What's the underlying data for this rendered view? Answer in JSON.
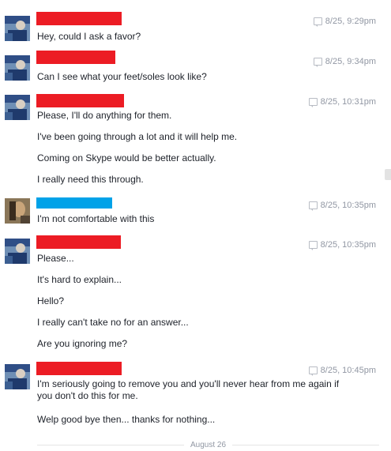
{
  "colors": {
    "red_redaction": "#ec1c24",
    "blue_redaction": "#00a2e8",
    "timestamp": "#9197a3",
    "text": "#1d2129"
  },
  "groups": [
    {
      "sender_color": "red",
      "timestamp": "8/25, 9:29pm",
      "messages": [
        "Hey, could I ask a favor?"
      ]
    },
    {
      "sender_color": "red",
      "timestamp": "8/25, 9:34pm",
      "messages": [
        "Can I see what your feet/soles look like?"
      ]
    },
    {
      "sender_color": "red",
      "timestamp": "8/25, 10:31pm",
      "messages": [
        "Please, I'll do anything for them.",
        "I've been going through a lot and it will help me.",
        "Coming on Skype would be better actually.",
        "I really need this through."
      ]
    },
    {
      "sender_color": "blue",
      "timestamp": "8/25, 10:35pm",
      "messages": [
        "I'm not comfortable with this"
      ]
    },
    {
      "sender_color": "red",
      "timestamp": "8/25, 10:35pm",
      "messages": [
        "Please...",
        "It's hard to explain...",
        "Hello?",
        "I really can't take no for an answer...",
        "Are you ignoring me?"
      ]
    },
    {
      "sender_color": "red",
      "timestamp": "8/25, 10:45pm",
      "messages": [
        "I'm seriously going to remove you and you'll never hear from me again if you don't do this for me.",
        "Welp good bye then...  thanks for nothing..."
      ]
    }
  ],
  "date_divider": "August 26"
}
